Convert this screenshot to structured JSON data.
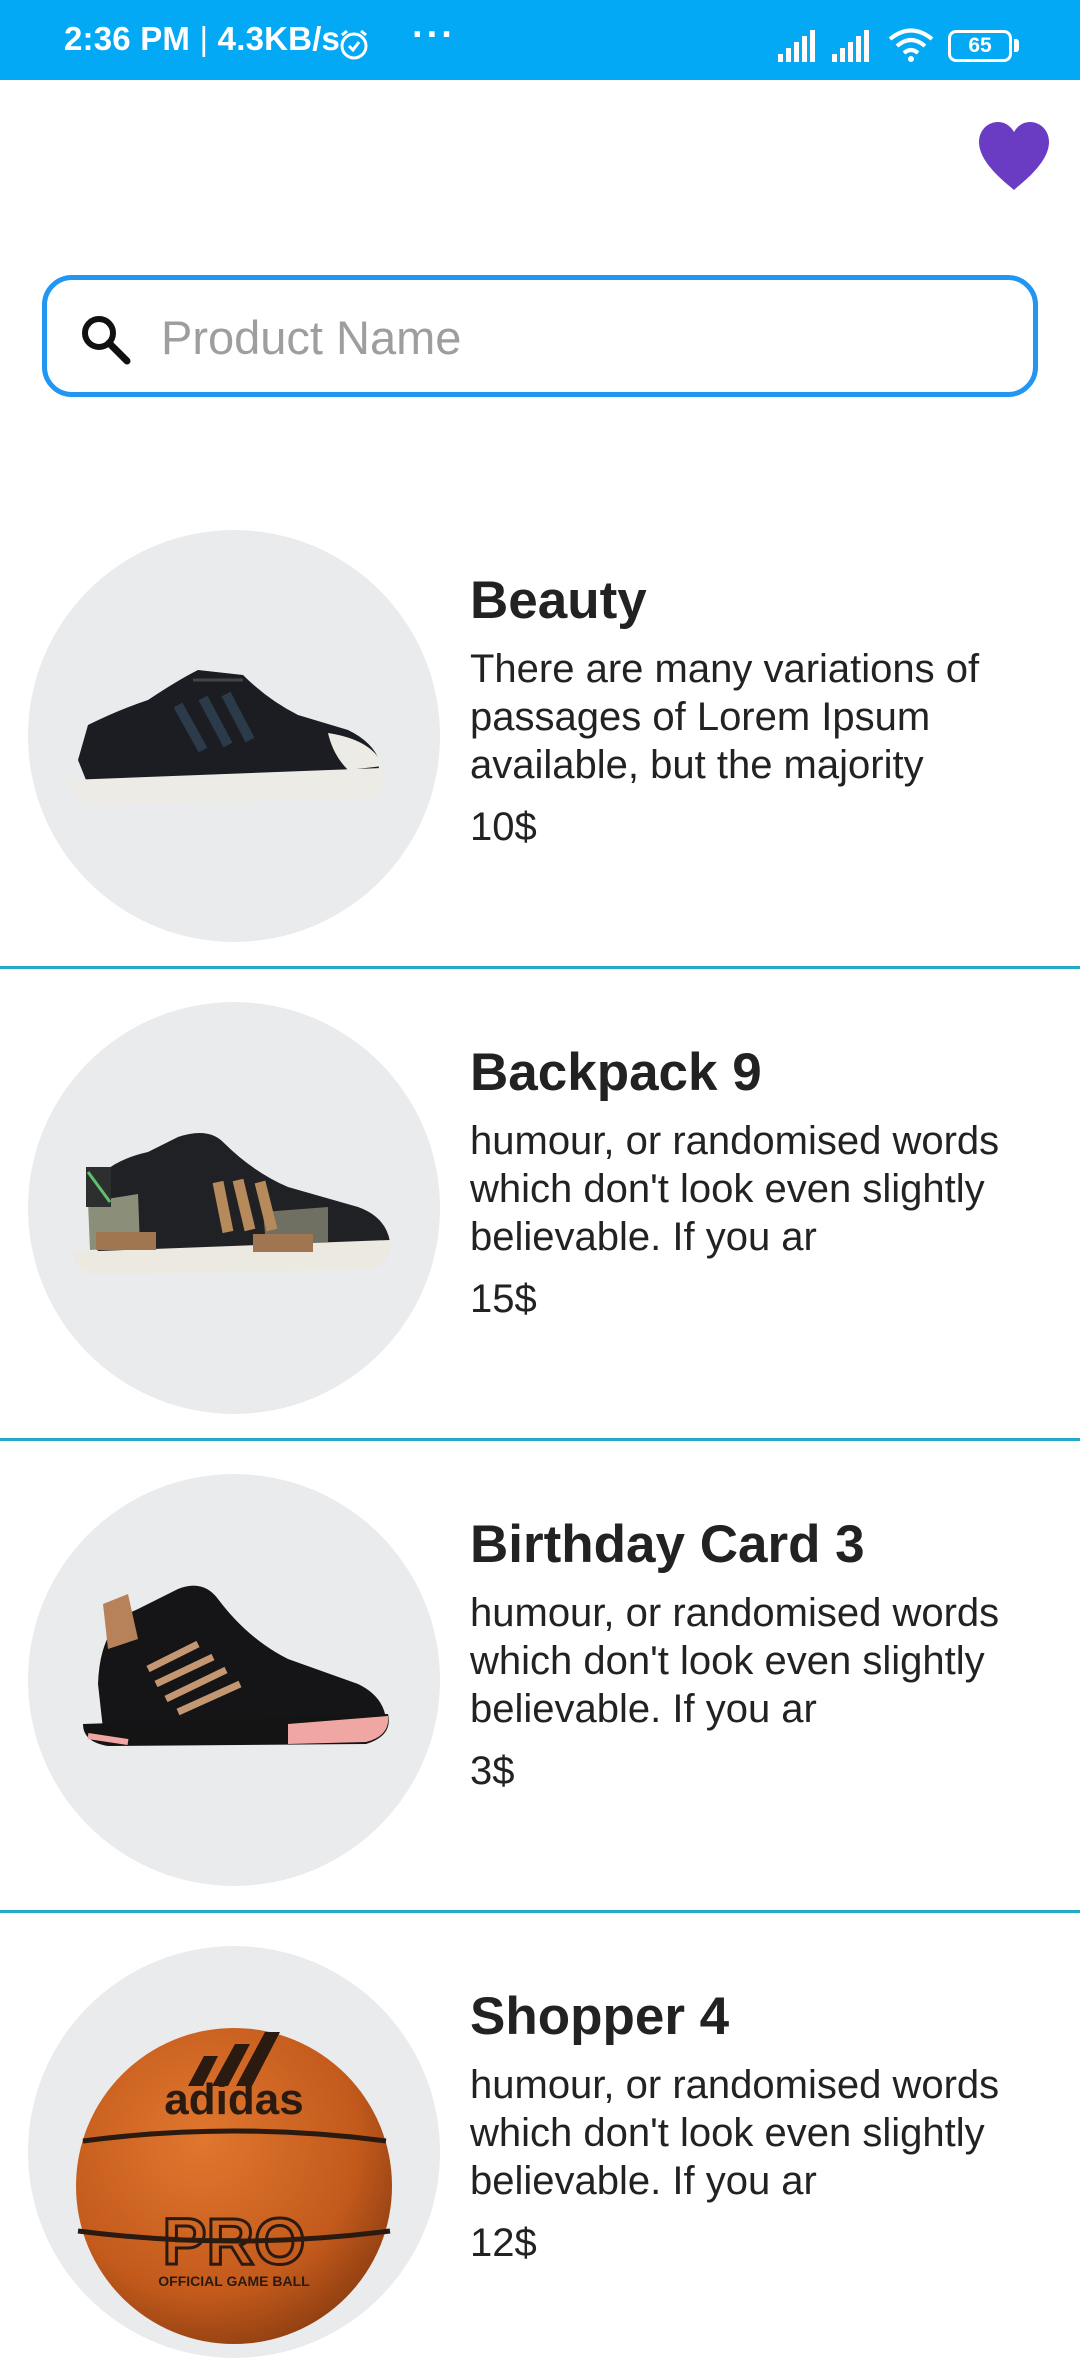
{
  "status_bar": {
    "time": "2:36 PM",
    "separator": "|",
    "speed": "4.3KB/s",
    "dots": "···",
    "battery": "65"
  },
  "header": {
    "favorite_icon": "heart-icon",
    "accent": "#6a3cc4"
  },
  "search": {
    "placeholder": "Product Name",
    "value": "",
    "border_color": "#2196F3"
  },
  "products": [
    {
      "title": "Beauty",
      "description": "There are many variations of passages of Lorem Ipsum available, but the majority",
      "price": "10$",
      "image": "black-sneaker"
    },
    {
      "title": "Backpack 9",
      "description": "humour, or randomised words which don't look even slightly believable. If you ar",
      "price": "15$",
      "image": "black-green-running-shoe"
    },
    {
      "title": "Birthday Card 3",
      "description": "humour, or randomised words which don't look even slightly believable. If you ar",
      "price": "3$",
      "image": "black-basketball-shoe"
    },
    {
      "title": "Shopper 4",
      "description": "humour, or randomised words which don't look even slightly believable. If you ar",
      "price": "12$",
      "image": "basketball",
      "image_text": [
        "adidas",
        "PRO",
        "OFFICIAL GAME BALL"
      ]
    }
  ]
}
